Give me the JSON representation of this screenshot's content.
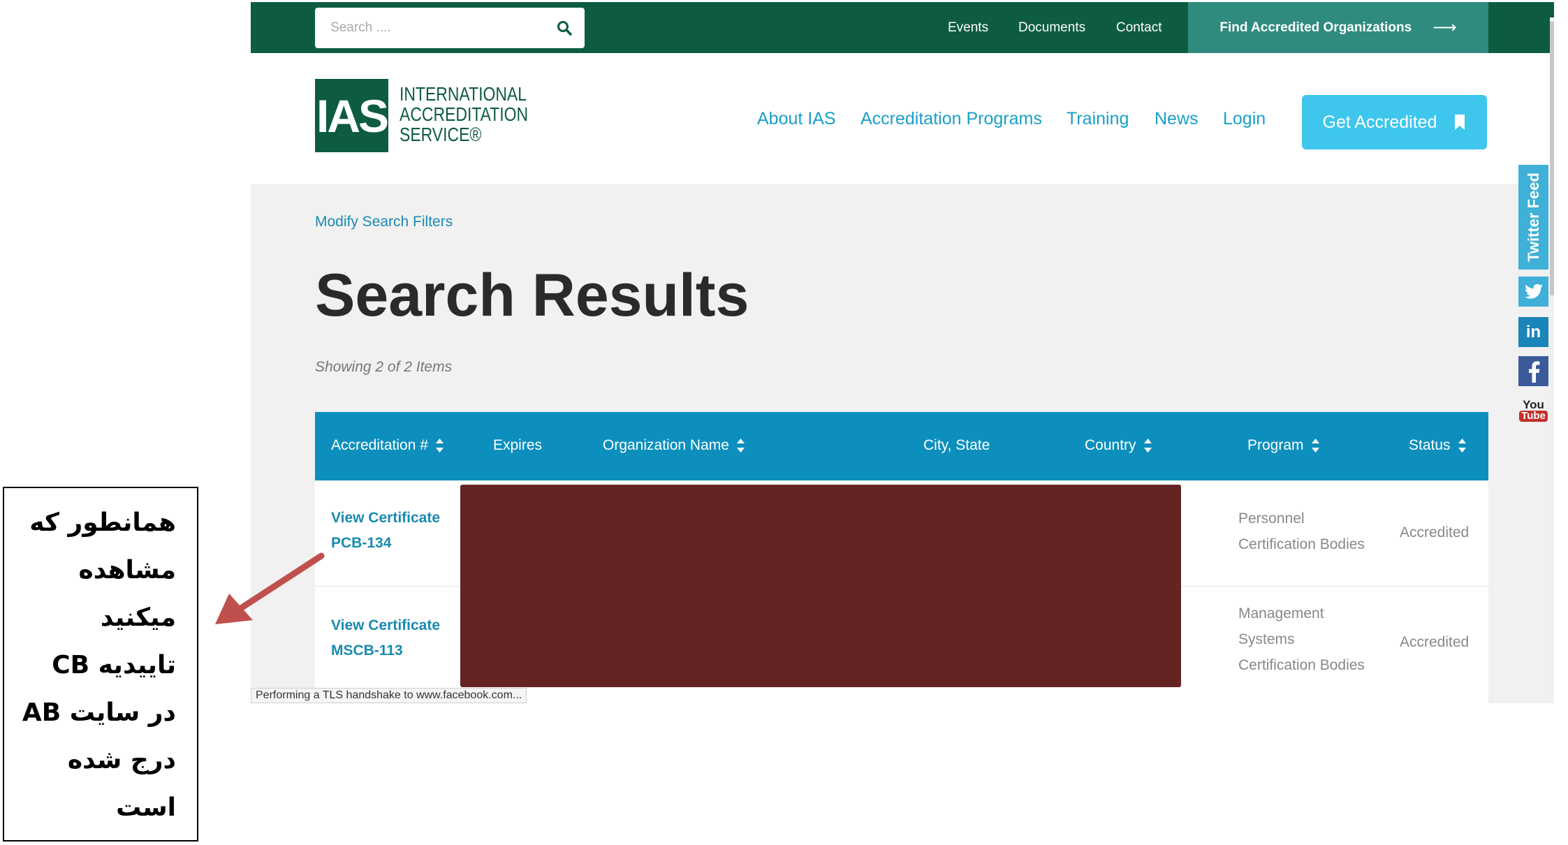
{
  "topbar": {
    "search_placeholder": "Search ....",
    "links": [
      "Events",
      "Documents",
      "Contact"
    ],
    "find_button": "Find Accredited Organizations",
    "find_arrow": "⟶"
  },
  "header": {
    "logo_mark": "IAS",
    "logo_lines": [
      "INTERNATIONAL",
      "ACCREDITATION",
      "SERVICE®"
    ],
    "nav": [
      "About IAS",
      "Accreditation Programs",
      "Training",
      "News",
      "Login"
    ],
    "cta": "Get Accredited"
  },
  "content": {
    "modify_link": "Modify Search Filters",
    "title": "Search Results",
    "showing": "Showing 2 of 2 Items"
  },
  "table": {
    "columns": [
      "Accreditation #",
      "Expires",
      "Organization Name",
      "City, State",
      "Country",
      "Program",
      "Status"
    ],
    "rows": [
      {
        "link": "View Certificate",
        "id": "PCB-134",
        "program": [
          "Personnel",
          "Certification Bodies"
        ],
        "status": "Accredited"
      },
      {
        "link": "View Certificate",
        "id": "MSCB-113",
        "program": [
          "Management",
          "Systems",
          "Certification Bodies"
        ],
        "status": "Accredited"
      }
    ]
  },
  "status_bar": "Performing a TLS handshake to www.facebook.com...",
  "social": {
    "twitter_feed": "Twitter Feed",
    "youtube": [
      "You",
      "Tube"
    ],
    "colors": {
      "twitter": "#3fb0d8",
      "linkedin": "#1b84b8",
      "facebook": "#3b5a9a",
      "youtube": "#c4302b"
    }
  },
  "annotation": {
    "lines": [
      "همانطور که",
      "مشاهده",
      "میکنید",
      "تاییدیه CB",
      "در سایت AB",
      "درج شده",
      "است"
    ]
  },
  "colors": {
    "brand_green": "#0d5c40",
    "accent_blue": "#1aa0c8",
    "table_header": "#0d8fbd",
    "redaction": "#642424"
  }
}
